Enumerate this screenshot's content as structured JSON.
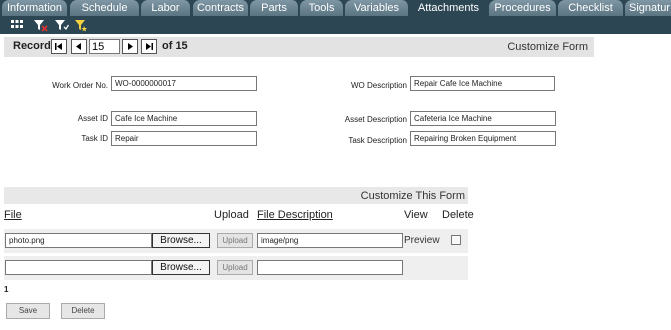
{
  "tabs": [
    {
      "label": "Information",
      "active": false
    },
    {
      "label": "Schedule",
      "active": false
    },
    {
      "label": "Labor",
      "active": false
    },
    {
      "label": "Contracts",
      "active": false
    },
    {
      "label": "Parts",
      "active": false
    },
    {
      "label": "Tools",
      "active": false
    },
    {
      "label": "Variables",
      "active": false
    },
    {
      "label": "Attachments",
      "active": true
    },
    {
      "label": "Procedures",
      "active": false
    },
    {
      "label": "Checklist",
      "active": false
    },
    {
      "label": "Signatur",
      "active": false
    }
  ],
  "toolbar": {
    "icons": [
      "grid-icon",
      "filter-clear-icon",
      "filter-icon",
      "filter-apply-icon"
    ]
  },
  "record": {
    "label": "Record:",
    "current": "15",
    "of_text": "of 15",
    "customize_label": "Customize Form"
  },
  "form": {
    "wo_number_label": "Work Order No.",
    "wo_number_value": "WO-0000000017",
    "wo_description_label": "WO Description",
    "wo_description_value": "Repair Cafe Ice Machine",
    "asset_id_label": "Asset ID",
    "asset_id_value": "Cafe Ice Machine",
    "asset_description_label": "Asset Description",
    "asset_description_value": "Cafeteria Ice Machine",
    "task_id_label": "Task ID",
    "task_id_value": "Repair",
    "task_description_label": "Task Description",
    "task_description_value": "Repairing Broken Equipment"
  },
  "attachments": {
    "customize_label": "Customize This Form",
    "columns": {
      "file": "File",
      "upload": "Upload",
      "file_description": "File Description",
      "view": "View",
      "delete": "Delete"
    },
    "rows": [
      {
        "file": "photo.png",
        "browse": "Browse...",
        "upload": "Upload",
        "description": "image/png",
        "view": "Preview",
        "delete_checked": false
      },
      {
        "file": "",
        "browse": "Browse...",
        "upload": "Upload",
        "description": ""
      }
    ],
    "count": "1"
  },
  "buttons": {
    "save": "Save",
    "delete": "Delete"
  },
  "colors": {
    "tabbar_bg": "#2c4654",
    "tab_inactive": "#6b8593",
    "panel_bg": "#e3e3e3"
  }
}
